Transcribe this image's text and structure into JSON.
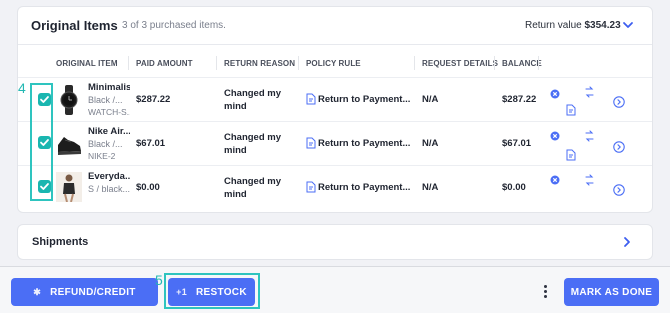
{
  "original_items": {
    "title": "Original Items",
    "subtitle": "3 of 3 purchased items.",
    "return_value_label": "Return value",
    "return_value": "$354.23",
    "columns": [
      "ORIGINAL ITEM",
      "PAID AMOUNT",
      "RETURN REASON",
      "POLICY RULE",
      "REQUEST DETAILS",
      "BALANCE"
    ],
    "rows": [
      {
        "name": "Minimalist",
        "variant": "Black /...",
        "sku": "WATCH-S...",
        "paid_amount": "$287.22",
        "reason": [
          "Changed my",
          "mind"
        ],
        "policy": "Return to Payment...",
        "details": "N/A",
        "balance": "$287.22",
        "selected": true
      },
      {
        "name": "Nike Air...",
        "variant": "Black /...",
        "sku": "NIKE-2",
        "paid_amount": "$67.01",
        "reason": [
          "Changed my",
          "mind"
        ],
        "policy": "Return to Payment...",
        "details": "N/A",
        "balance": "$67.01",
        "selected": true
      },
      {
        "name": "Everyda...",
        "variant": "S / black...",
        "sku": "",
        "paid_amount": "$0.00",
        "reason": [
          "Changed my",
          "mind"
        ],
        "policy": "Return to Payment...",
        "details": "N/A",
        "balance": "$0.00",
        "selected": true
      }
    ]
  },
  "annotations": {
    "checkbox_column": "4",
    "restock_button": "5"
  },
  "shipments": {
    "title": "Shipments"
  },
  "footer": {
    "refund_label": "REFUND/CREDIT",
    "restock_label": "RESTOCK",
    "restock_icon_text": "+1",
    "mark_done_label": "MARK AS DONE"
  },
  "colors": {
    "primary": "#4b6ef5",
    "teal": "#1ab6b0",
    "annotation": "#23b8b3"
  },
  "icons": [
    "chevron-down-icon",
    "checkbox-checked-icon",
    "policy-document-icon",
    "remove-x-icon",
    "exchange-icon",
    "arrow-circle-right-icon",
    "chevron-right-icon",
    "kebab-menu-icon"
  ]
}
